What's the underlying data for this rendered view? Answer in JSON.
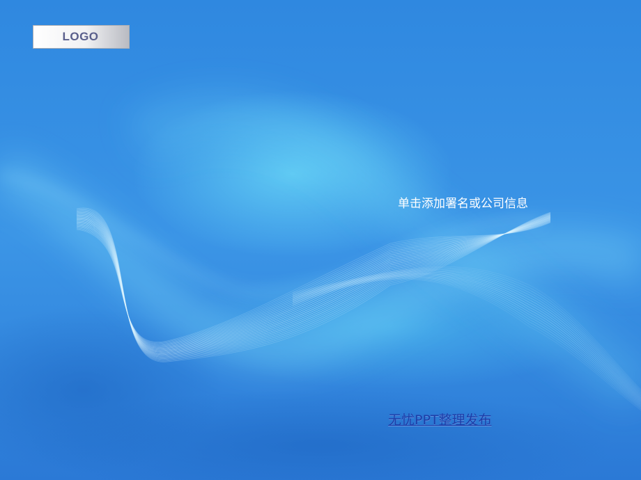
{
  "slide": {
    "logo_label": "LOGO",
    "subtitle": "单击添加署名或公司信息",
    "footer_link": "无忧PPT整理发布"
  },
  "colors": {
    "background": "#2f7fd9",
    "wave_highlight": "#5ad0f5",
    "subtitle_text": "#ffffff",
    "footer_link_text": "#1c3ea8"
  }
}
